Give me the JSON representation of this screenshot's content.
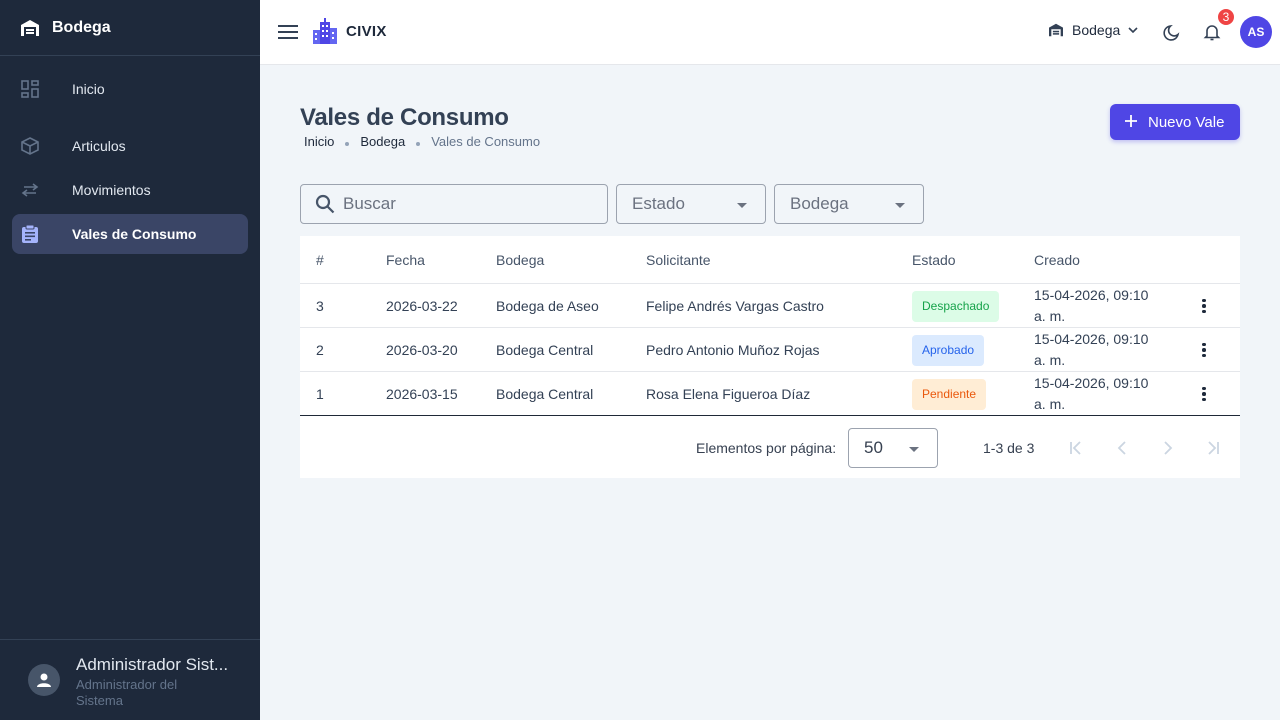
{
  "sidebar": {
    "title": "Bodega",
    "items": [
      {
        "label": "Inicio",
        "icon": "dashboard-icon"
      },
      {
        "label": "Articulos",
        "icon": "box-icon"
      },
      {
        "label": "Movimientos",
        "icon": "swap-icon"
      },
      {
        "label": "Vales de Consumo",
        "icon": "clipboard-icon",
        "active": true
      }
    ],
    "user": {
      "name": "Administrador Sist...",
      "role": "Administrador del Sistema"
    }
  },
  "topbar": {
    "brand": "CIVIX",
    "context": "Bodega",
    "notifications": "3",
    "avatar_initials": "AS"
  },
  "page": {
    "title": "Vales de Consumo",
    "breadcrumb": [
      "Inicio",
      "Bodega",
      "Vales de Consumo"
    ],
    "new_button": "Nuevo Vale"
  },
  "filters": {
    "search_placeholder": "Buscar",
    "estado_placeholder": "Estado",
    "bodega_placeholder": "Bodega"
  },
  "table": {
    "headers": [
      "#",
      "Fecha",
      "Bodega",
      "Solicitante",
      "Estado",
      "Creado"
    ],
    "rows": [
      {
        "id": "3",
        "fecha": "2026-03-22",
        "bodega": "Bodega de Aseo",
        "solicitante": "Felipe Andrés Vargas Castro",
        "estado": "Despachado",
        "creado": "15-04-2026, 09:10 a. m."
      },
      {
        "id": "2",
        "fecha": "2026-03-20",
        "bodega": "Bodega Central",
        "solicitante": "Pedro Antonio Muñoz Rojas",
        "estado": "Aprobado",
        "creado": "15-04-2026, 09:10 a. m."
      },
      {
        "id": "1",
        "fecha": "2026-03-15",
        "bodega": "Bodega Central",
        "solicitante": "Rosa Elena Figueroa Díaz",
        "estado": "Pendiente",
        "creado": "15-04-2026, 09:10 a. m."
      }
    ]
  },
  "paginator": {
    "label": "Elementos por página:",
    "page_size": "50",
    "range": "1-3 de 3"
  },
  "colors": {
    "accent": "#4f46e5",
    "sidebar_bg": "#1e293b",
    "despachado_bg": "#dcfce7",
    "despachado_fg": "#16a34a",
    "aprobado_bg": "#dbeafe",
    "aprobado_fg": "#2563eb",
    "pendiente_bg": "#ffedd5",
    "pendiente_fg": "#ea580c"
  }
}
